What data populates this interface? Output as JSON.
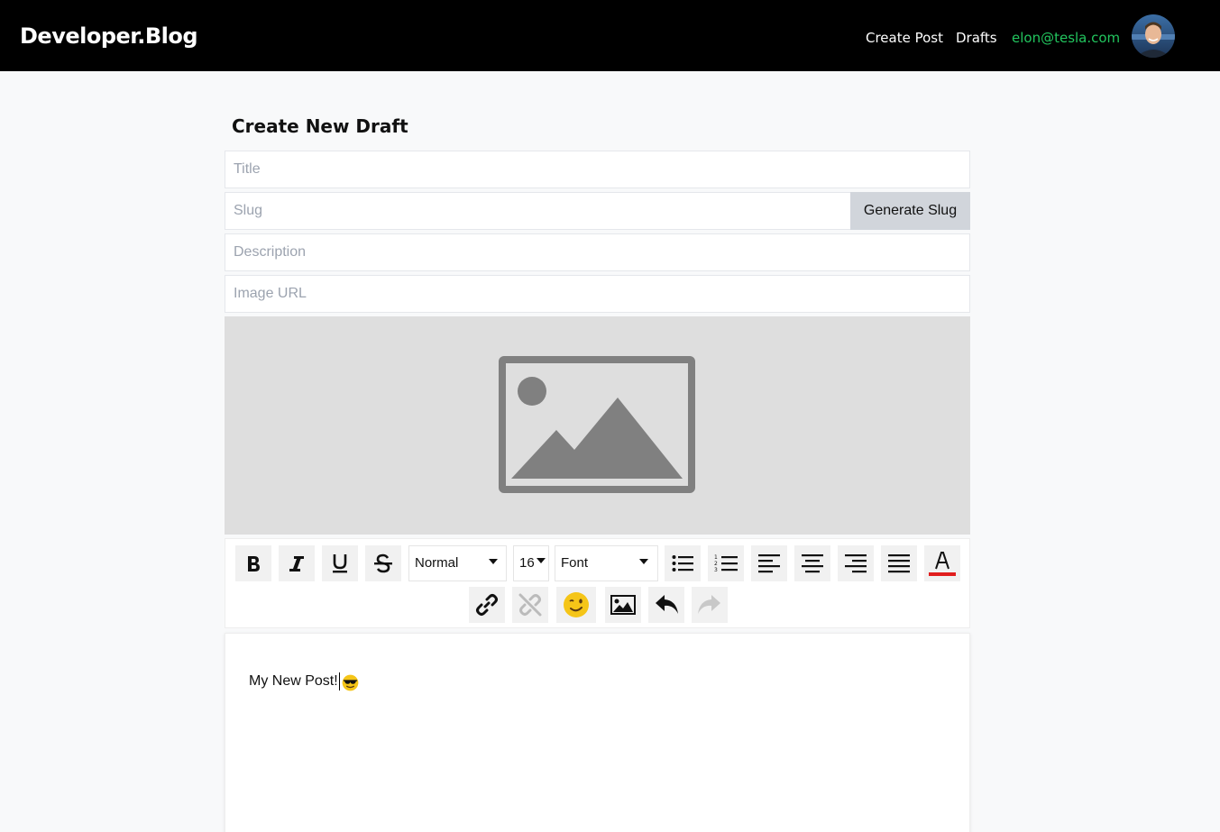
{
  "navbar": {
    "brand": "Developer.Blog",
    "links": {
      "create_post": "Create Post",
      "drafts": "Drafts"
    },
    "user_email": "elon@tesla.com"
  },
  "page": {
    "title": "Create New Draft"
  },
  "form": {
    "title_placeholder": "Title",
    "slug_placeholder": "Slug",
    "generate_slug_label": "Generate Slug",
    "description_placeholder": "Description",
    "image_url_placeholder": "Image URL"
  },
  "toolbar": {
    "block_type": "Normal",
    "font_size": "16",
    "font_family": "Font",
    "buttons": [
      "bold",
      "italic",
      "underline",
      "strikethrough",
      "unordered-list",
      "ordered-list",
      "align-left",
      "align-center",
      "align-right",
      "justify",
      "font-color",
      "link",
      "unlink",
      "emoji",
      "image",
      "undo",
      "redo"
    ]
  },
  "editor": {
    "content": "My New Post!"
  },
  "colors": {
    "accent_green": "#22c55e",
    "font_color_bar": "#e11d1d",
    "navbar_bg": "#000000"
  }
}
